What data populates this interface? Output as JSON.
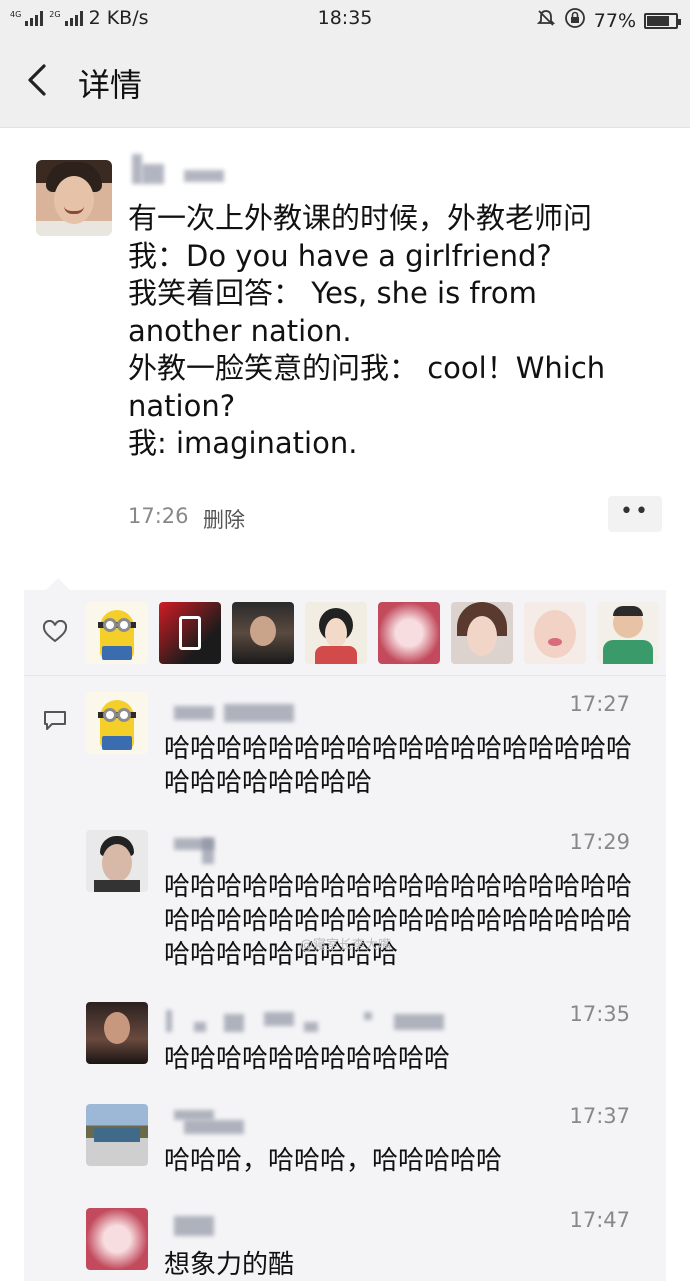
{
  "status_bar": {
    "network_speed": "2 KB/s",
    "signal_1_label": "4G",
    "signal_2_label": "2G",
    "time": "18:35",
    "battery_percent": "77%",
    "battery_level": 0.77
  },
  "nav": {
    "title": "详情"
  },
  "post": {
    "text": "有一次上外教课的时候，外教老师问\n我：Do you have a girlfriend?\n我笑着回答： Yes, she is from\nanother nation.\n外教一脸笑意的问我： cool！Which\nnation?\n我: imagination.",
    "time": "17:26",
    "delete_label": "删除",
    "more_label": "••"
  },
  "likes": {
    "count": 8
  },
  "comments": [
    {
      "time": "17:27",
      "text": "哈哈哈哈哈哈哈哈哈哈哈哈哈哈哈哈哈哈哈哈哈哈哈哈哈哈"
    },
    {
      "time": "17:29",
      "text": "哈哈哈哈哈哈哈哈哈哈哈哈哈哈哈哈哈哈哈哈哈哈哈哈哈哈哈哈哈哈哈哈哈哈哈哈哈哈哈哈哈哈哈哈哈"
    },
    {
      "time": "17:35",
      "text": "哈哈哈哈哈哈哈哈哈哈哈"
    },
    {
      "time": "17:37",
      "text": "哈哈哈，哈哈哈，哈哈哈哈哈"
    },
    {
      "time": "17:47",
      "text": "想象力的酷"
    }
  ],
  "watermark": "@寝室长李大嘴",
  "colors": {
    "page_bg": "#ffffff",
    "header_bg": "#efefef",
    "comment_bg": "#f4f4f6",
    "meta_text": "#888888"
  }
}
